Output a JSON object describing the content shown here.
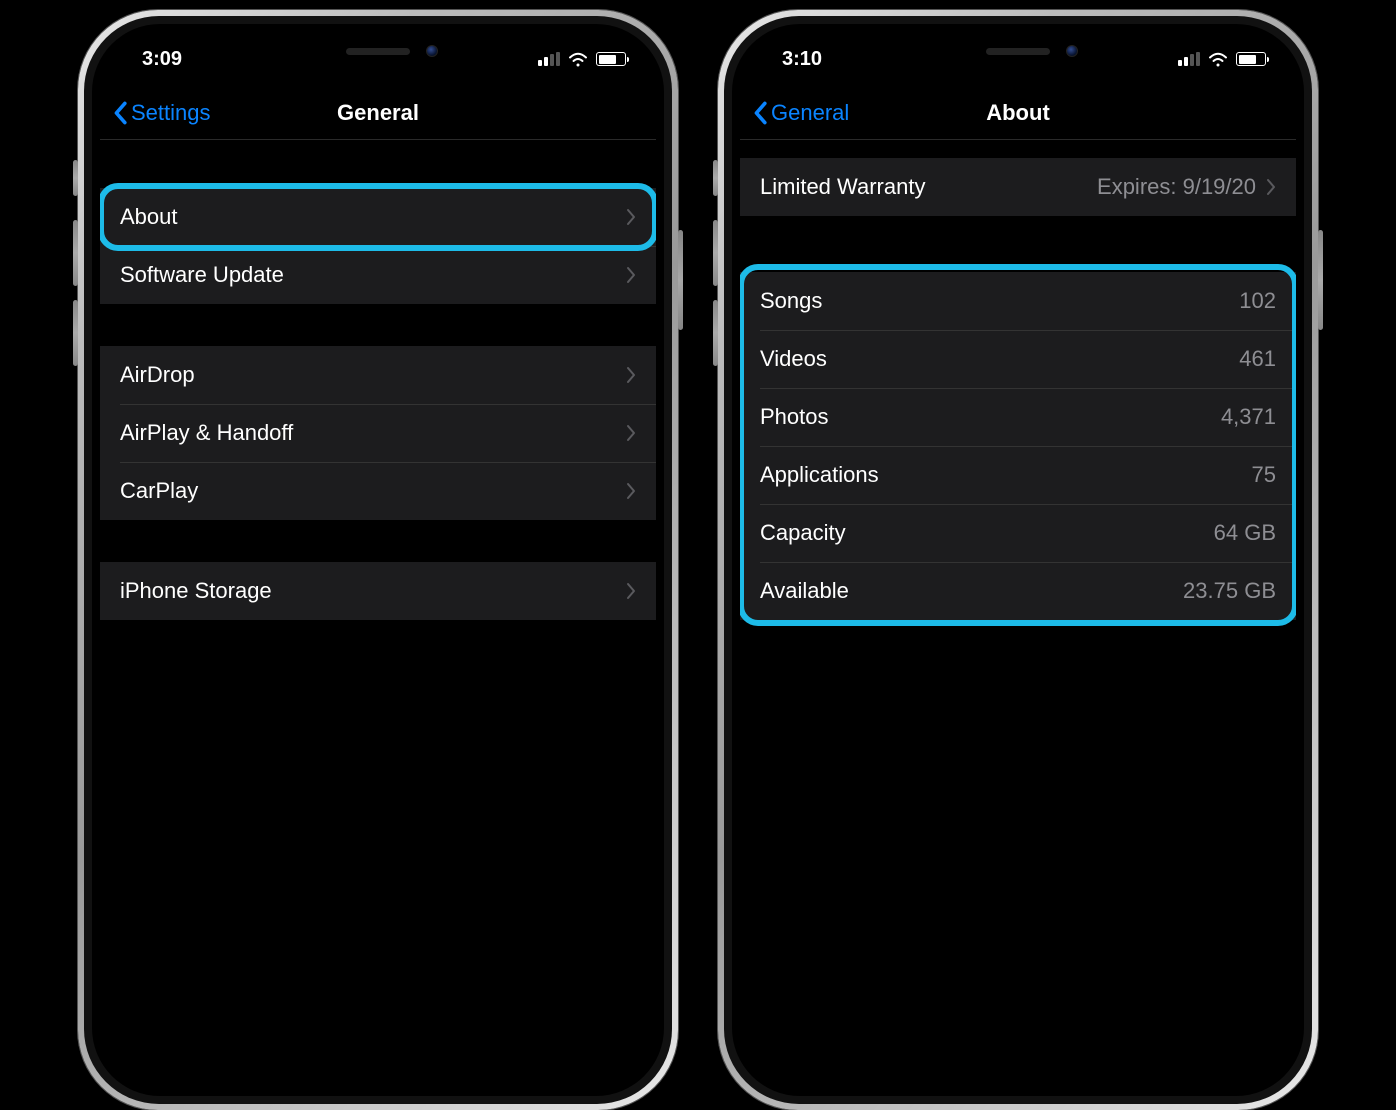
{
  "left_phone": {
    "status": {
      "time": "3:09"
    },
    "nav": {
      "back_label": "Settings",
      "title": "General"
    },
    "group1": [
      {
        "label": "About",
        "has_chevron": true
      },
      {
        "label": "Software Update",
        "has_chevron": true
      }
    ],
    "group2": [
      {
        "label": "AirDrop",
        "has_chevron": true
      },
      {
        "label": "AirPlay & Handoff",
        "has_chevron": true
      },
      {
        "label": "CarPlay",
        "has_chevron": true
      }
    ],
    "group3": [
      {
        "label": "iPhone Storage",
        "has_chevron": true
      }
    ]
  },
  "right_phone": {
    "status": {
      "time": "3:10"
    },
    "nav": {
      "back_label": "General",
      "title": "About"
    },
    "warranty": {
      "label": "Limited Warranty",
      "value": "Expires: 9/19/20"
    },
    "stats": [
      {
        "label": "Songs",
        "value": "102"
      },
      {
        "label": "Videos",
        "value": "461"
      },
      {
        "label": "Photos",
        "value": "4,371"
      },
      {
        "label": "Applications",
        "value": "75"
      },
      {
        "label": "Capacity",
        "value": "64 GB"
      },
      {
        "label": "Available",
        "value": "23.75 GB"
      }
    ]
  }
}
